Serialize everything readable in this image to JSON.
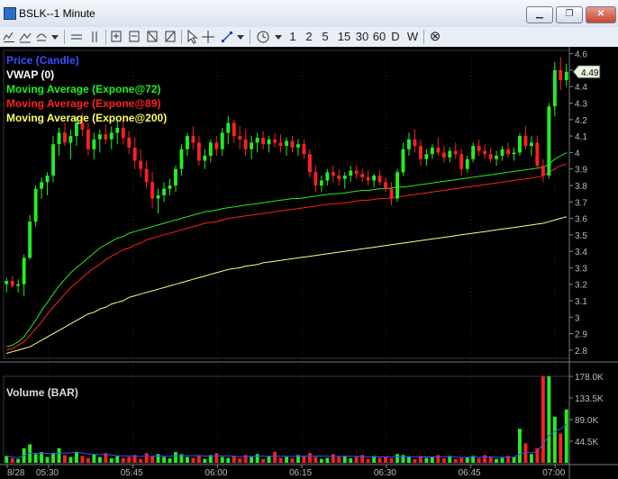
{
  "window": {
    "title": "BSLK--1 Minute",
    "minimize": "▁",
    "restore": "❐",
    "close": "✕"
  },
  "toolbar": {
    "left_tools": [
      "chart-type",
      "drawing",
      "alerts"
    ],
    "periods": [
      "1",
      "2",
      "5",
      "15",
      "30",
      "60",
      "D",
      "W"
    ],
    "close_symbol": "⊗"
  },
  "legend": [
    {
      "label": "Price (Candle)",
      "color": "#3b4bff"
    },
    {
      "label": "VWAP (0)",
      "color": "#ffffff"
    },
    {
      "label": "Moving Average (Expone@72)",
      "color": "#22ee22"
    },
    {
      "label": "Moving Average (Expone@89)",
      "color": "#ff2020"
    },
    {
      "label": "Moving Average (Expone@200)",
      "color": "#ffff66"
    }
  ],
  "volume_label": "Volume (BAR)",
  "price_axis": {
    "ticks": [
      "4.6",
      "4.5",
      "4.4",
      "4.3",
      "4.2",
      "4.1",
      "4",
      "3.9",
      "3.8",
      "3.7",
      "3.6",
      "3.5",
      "3.4",
      "3.3",
      "3.2",
      "3.1",
      "3",
      "2.9",
      "2.8"
    ],
    "last_price": "4.49"
  },
  "volume_axis": {
    "ticks": [
      "178.0K",
      "133.5K",
      "89.0K",
      "44.5K"
    ]
  },
  "time_axis": {
    "labels": [
      "8/28",
      "05:30",
      "05:45",
      "06:00",
      "06:15",
      "06:30",
      "06:45",
      "07:00"
    ]
  },
  "chart_data": {
    "type": "candlestick",
    "title": "BSLK--1 Minute",
    "ylim": [
      2.75,
      4.62
    ],
    "volume_ylim": [
      0,
      178000
    ],
    "up_color": "#22ee22",
    "down_color": "#ff2020",
    "candles": [
      [
        3.2,
        3.24,
        3.15,
        3.22
      ],
      [
        3.22,
        3.25,
        3.18,
        3.19
      ],
      [
        3.19,
        3.23,
        3.15,
        3.2
      ],
      [
        3.2,
        3.38,
        3.13,
        3.36
      ],
      [
        3.36,
        3.62,
        3.35,
        3.58
      ],
      [
        3.58,
        3.8,
        3.55,
        3.78
      ],
      [
        3.78,
        3.85,
        3.72,
        3.82
      ],
      [
        3.82,
        3.88,
        3.74,
        3.86
      ],
      [
        3.86,
        4.1,
        3.82,
        4.05
      ],
      [
        4.05,
        4.15,
        3.98,
        4.12
      ],
      [
        4.12,
        4.18,
        4.04,
        4.06
      ],
      [
        4.06,
        4.14,
        3.96,
        4.1
      ],
      [
        4.1,
        4.22,
        4.04,
        4.18
      ],
      [
        4.18,
        4.24,
        4.1,
        4.14
      ],
      [
        4.14,
        4.18,
        3.98,
        4.02
      ],
      [
        4.02,
        4.12,
        3.96,
        4.08
      ],
      [
        4.08,
        4.14,
        4.0,
        4.11
      ],
      [
        4.11,
        4.17,
        4.05,
        4.08
      ],
      [
        4.08,
        4.16,
        4.02,
        4.12
      ],
      [
        4.12,
        4.2,
        4.05,
        4.15
      ],
      [
        4.15,
        4.19,
        4.05,
        4.09
      ],
      [
        4.09,
        4.13,
        3.99,
        4.03
      ],
      [
        4.03,
        4.09,
        3.9,
        3.95
      ],
      [
        3.95,
        4.02,
        3.85,
        3.9
      ],
      [
        3.9,
        3.95,
        3.78,
        3.82
      ],
      [
        3.82,
        3.88,
        3.66,
        3.72
      ],
      [
        3.72,
        3.78,
        3.63,
        3.74
      ],
      [
        3.74,
        3.82,
        3.7,
        3.78
      ],
      [
        3.78,
        3.84,
        3.74,
        3.8
      ],
      [
        3.8,
        3.92,
        3.76,
        3.9
      ],
      [
        3.9,
        4.05,
        3.86,
        4.02
      ],
      [
        4.02,
        4.12,
        3.98,
        4.1
      ],
      [
        4.1,
        4.16,
        4.02,
        4.06
      ],
      [
        4.06,
        4.1,
        3.92,
        3.95
      ],
      [
        3.95,
        4.02,
        3.9,
        3.98
      ],
      [
        3.98,
        4.08,
        3.94,
        4.06
      ],
      [
        4.06,
        4.1,
        3.98,
        4.02
      ],
      [
        4.02,
        4.15,
        3.98,
        4.12
      ],
      [
        4.12,
        4.22,
        4.05,
        4.18
      ],
      [
        4.18,
        4.2,
        4.06,
        4.1
      ],
      [
        4.1,
        4.16,
        4.02,
        4.08
      ],
      [
        4.08,
        4.14,
        3.98,
        4.02
      ],
      [
        4.02,
        4.1,
        3.96,
        4.06
      ],
      [
        4.06,
        4.12,
        4.0,
        4.09
      ],
      [
        4.09,
        4.13,
        4.02,
        4.05
      ],
      [
        4.05,
        4.1,
        4.0,
        4.08
      ],
      [
        4.08,
        4.12,
        4.03,
        4.06
      ],
      [
        4.06,
        4.11,
        4.0,
        4.04
      ],
      [
        4.04,
        4.09,
        3.98,
        4.07
      ],
      [
        4.07,
        4.1,
        4.0,
        4.03
      ],
      [
        4.03,
        4.08,
        3.98,
        4.05
      ],
      [
        4.05,
        4.08,
        3.96,
        3.99
      ],
      [
        3.99,
        4.02,
        3.85,
        3.88
      ],
      [
        3.88,
        3.92,
        3.76,
        3.8
      ],
      [
        3.8,
        3.86,
        3.76,
        3.83
      ],
      [
        3.83,
        3.9,
        3.8,
        3.88
      ],
      [
        3.88,
        3.92,
        3.82,
        3.86
      ],
      [
        3.86,
        3.9,
        3.8,
        3.84
      ],
      [
        3.84,
        3.88,
        3.78,
        3.86
      ],
      [
        3.86,
        3.92,
        3.82,
        3.89
      ],
      [
        3.89,
        3.92,
        3.84,
        3.87
      ],
      [
        3.87,
        3.9,
        3.82,
        3.85
      ],
      [
        3.85,
        3.89,
        3.8,
        3.83
      ],
      [
        3.83,
        3.87,
        3.79,
        3.86
      ],
      [
        3.86,
        3.89,
        3.8,
        3.82
      ],
      [
        3.82,
        3.85,
        3.76,
        3.78
      ],
      [
        3.78,
        3.82,
        3.68,
        3.72
      ],
      [
        3.72,
        3.9,
        3.7,
        3.88
      ],
      [
        3.88,
        4.06,
        3.86,
        4.02
      ],
      [
        4.02,
        4.12,
        3.98,
        4.08
      ],
      [
        4.08,
        4.14,
        4.0,
        4.04
      ],
      [
        4.04,
        4.08,
        3.92,
        3.96
      ],
      [
        3.96,
        4.02,
        3.92,
        3.99
      ],
      [
        3.99,
        4.05,
        3.96,
        4.03
      ],
      [
        4.03,
        4.09,
        3.98,
        4.0
      ],
      [
        4.0,
        4.04,
        3.94,
        3.97
      ],
      [
        3.97,
        4.03,
        3.94,
        4.01
      ],
      [
        4.01,
        4.06,
        3.96,
        3.99
      ],
      [
        3.99,
        4.02,
        3.86,
        3.9
      ],
      [
        3.9,
        3.98,
        3.88,
        3.96
      ],
      [
        3.96,
        4.06,
        3.94,
        4.04
      ],
      [
        4.04,
        4.08,
        3.98,
        4.01
      ],
      [
        4.01,
        4.05,
        3.96,
        3.99
      ],
      [
        3.99,
        4.03,
        3.94,
        3.96
      ],
      [
        3.96,
        4.01,
        3.92,
        3.98
      ],
      [
        3.98,
        4.04,
        3.95,
        4.02
      ],
      [
        4.02,
        4.06,
        3.97,
        3.99
      ],
      [
        3.99,
        4.03,
        3.95,
        4.0
      ],
      [
        4.0,
        4.12,
        3.98,
        4.1
      ],
      [
        4.1,
        4.16,
        4.02,
        4.04
      ],
      [
        4.04,
        4.1,
        3.98,
        4.06
      ],
      [
        4.06,
        4.1,
        3.9,
        3.92
      ],
      [
        3.92,
        3.96,
        3.82,
        3.86
      ],
      [
        3.86,
        4.3,
        3.84,
        4.28
      ],
      [
        4.28,
        4.55,
        4.22,
        4.5
      ],
      [
        4.5,
        4.58,
        4.38,
        4.44
      ],
      [
        4.44,
        4.54,
        4.4,
        4.49
      ]
    ],
    "ema72": [
      2.82,
      2.83,
      2.85,
      2.88,
      2.93,
      2.98,
      3.04,
      3.09,
      3.14,
      3.19,
      3.23,
      3.27,
      3.3,
      3.33,
      3.36,
      3.39,
      3.42,
      3.44,
      3.46,
      3.48,
      3.49,
      3.51,
      3.52,
      3.53,
      3.54,
      3.55,
      3.56,
      3.57,
      3.58,
      3.59,
      3.6,
      3.61,
      3.62,
      3.63,
      3.64,
      3.645,
      3.65,
      3.66,
      3.665,
      3.67,
      3.675,
      3.68,
      3.685,
      3.69,
      3.695,
      3.7,
      3.705,
      3.71,
      3.715,
      3.72,
      3.72,
      3.725,
      3.73,
      3.735,
      3.74,
      3.745,
      3.75,
      3.75,
      3.755,
      3.76,
      3.765,
      3.77,
      3.77,
      3.775,
      3.78,
      3.78,
      3.785,
      3.79,
      3.79,
      3.795,
      3.8,
      3.805,
      3.81,
      3.815,
      3.82,
      3.825,
      3.83,
      3.835,
      3.84,
      3.845,
      3.85,
      3.855,
      3.86,
      3.865,
      3.87,
      3.875,
      3.88,
      3.885,
      3.89,
      3.895,
      3.9,
      3.905,
      3.91,
      3.93,
      3.96,
      3.98,
      4.0
    ],
    "ema89": [
      2.8,
      2.81,
      2.83,
      2.85,
      2.89,
      2.93,
      2.97,
      3.02,
      3.06,
      3.1,
      3.14,
      3.18,
      3.21,
      3.24,
      3.27,
      3.3,
      3.32,
      3.35,
      3.37,
      3.39,
      3.41,
      3.42,
      3.44,
      3.45,
      3.47,
      3.48,
      3.49,
      3.5,
      3.51,
      3.52,
      3.53,
      3.54,
      3.55,
      3.56,
      3.57,
      3.575,
      3.58,
      3.59,
      3.6,
      3.605,
      3.61,
      3.615,
      3.62,
      3.625,
      3.63,
      3.635,
      3.64,
      3.645,
      3.65,
      3.655,
      3.66,
      3.665,
      3.67,
      3.675,
      3.68,
      3.685,
      3.69,
      3.69,
      3.695,
      3.7,
      3.705,
      3.71,
      3.71,
      3.715,
      3.72,
      3.72,
      3.725,
      3.73,
      3.735,
      3.74,
      3.745,
      3.75,
      3.755,
      3.76,
      3.765,
      3.77,
      3.775,
      3.78,
      3.785,
      3.79,
      3.795,
      3.8,
      3.805,
      3.81,
      3.815,
      3.82,
      3.825,
      3.83,
      3.835,
      3.84,
      3.845,
      3.85,
      3.86,
      3.88,
      3.9,
      3.92,
      3.93
    ],
    "ema200": [
      2.78,
      2.79,
      2.8,
      2.81,
      2.82,
      2.84,
      2.86,
      2.88,
      2.9,
      2.92,
      2.94,
      2.96,
      2.98,
      3.0,
      3.02,
      3.03,
      3.05,
      3.06,
      3.08,
      3.09,
      3.1,
      3.12,
      3.13,
      3.14,
      3.15,
      3.16,
      3.17,
      3.18,
      3.19,
      3.2,
      3.21,
      3.22,
      3.23,
      3.24,
      3.25,
      3.26,
      3.27,
      3.28,
      3.29,
      3.295,
      3.3,
      3.31,
      3.315,
      3.32,
      3.33,
      3.335,
      3.34,
      3.345,
      3.35,
      3.355,
      3.36,
      3.365,
      3.37,
      3.375,
      3.38,
      3.385,
      3.39,
      3.395,
      3.4,
      3.405,
      3.41,
      3.415,
      3.42,
      3.425,
      3.43,
      3.435,
      3.44,
      3.445,
      3.45,
      3.455,
      3.46,
      3.465,
      3.47,
      3.475,
      3.48,
      3.485,
      3.49,
      3.495,
      3.5,
      3.505,
      3.51,
      3.515,
      3.52,
      3.525,
      3.53,
      3.535,
      3.54,
      3.545,
      3.55,
      3.555,
      3.56,
      3.565,
      3.57,
      3.58,
      3.59,
      3.6,
      3.61
    ],
    "volume": [
      14000,
      9000,
      8000,
      30000,
      38000,
      18000,
      22000,
      12000,
      20000,
      30000,
      16000,
      12000,
      22000,
      14000,
      10000,
      18000,
      12000,
      20000,
      9000,
      14000,
      10000,
      12000,
      16000,
      8000,
      20000,
      14000,
      18000,
      12000,
      9000,
      22000,
      18000,
      12000,
      10000,
      14000,
      8000,
      16000,
      20000,
      12000,
      10000,
      14000,
      9000,
      16000,
      12000,
      18000,
      8000,
      14000,
      22000,
      10000,
      12000,
      9000,
      16000,
      14000,
      20000,
      12000,
      8000,
      10000,
      18000,
      12000,
      14000,
      9000,
      12000,
      16000,
      8000,
      14000,
      10000,
      12000,
      9000,
      18000,
      16000,
      12000,
      8000,
      14000,
      10000,
      12000,
      16000,
      9000,
      14000,
      8000,
      10000,
      12000,
      14000,
      9000,
      16000,
      12000,
      8000,
      10000,
      14000,
      12000,
      70000,
      40000,
      18000,
      30000,
      178000,
      178000,
      95000,
      60000,
      110000
    ]
  }
}
